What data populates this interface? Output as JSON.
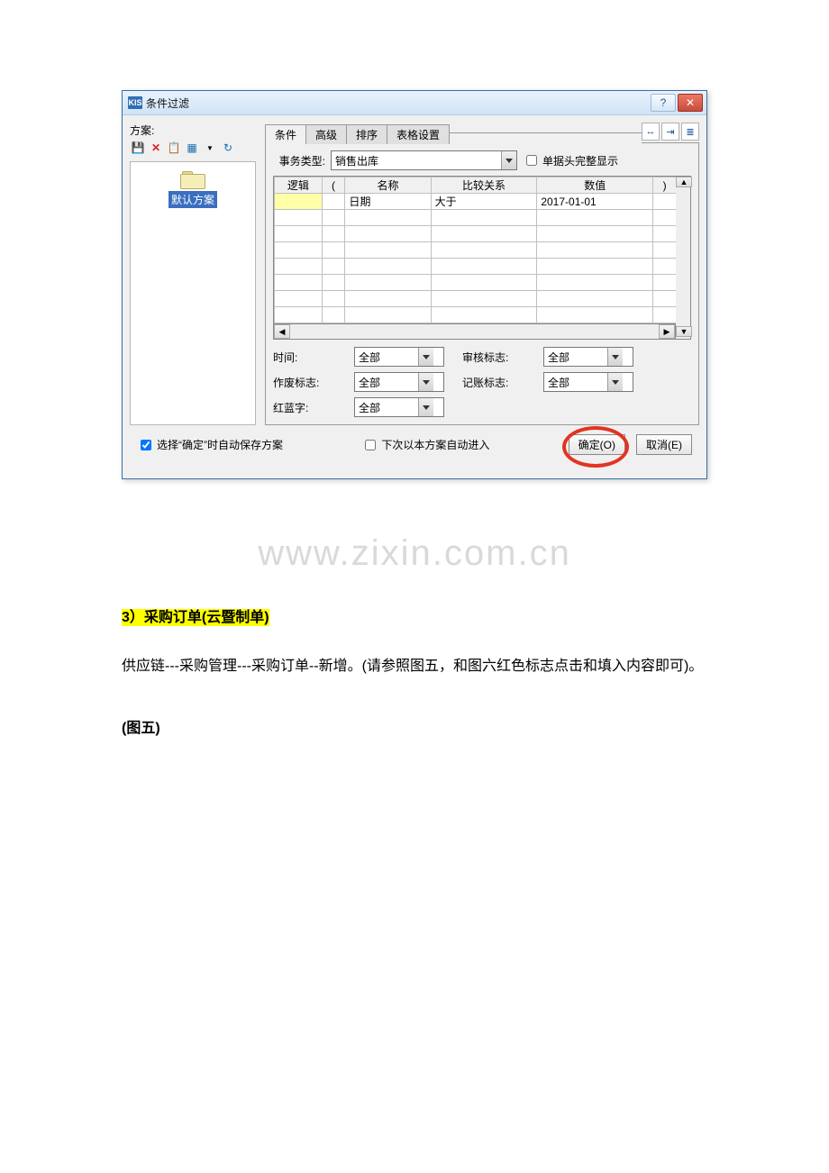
{
  "window": {
    "icon_text": "KIS",
    "title": "条件过滤",
    "help_symbol": "?",
    "close_symbol": "✕"
  },
  "left_pane": {
    "label": "方案:",
    "toolbar": {
      "save": "💾",
      "delete": "✕",
      "copy": "📋",
      "grid": "▦",
      "tri": "▼",
      "refresh": "↻"
    },
    "default_scheme": "默认方案"
  },
  "tabs": {
    "condition": "条件",
    "advanced": "高级",
    "sort": "排序",
    "table_settings": "表格设置"
  },
  "tab_icons": {
    "a": "↔",
    "b": "⇥",
    "c": "≣"
  },
  "business_type": {
    "label": "事务类型:",
    "value": "销售出库"
  },
  "full_display": {
    "label": "单据头完整显示"
  },
  "grid": {
    "headers": {
      "logic": "逻辑",
      "lparen": "(",
      "name": "名称",
      "compare": "比较关系",
      "value": "数值",
      "rparen": ")"
    },
    "row1": {
      "logic": "",
      "lparen": "",
      "name": "日期",
      "compare": "大于",
      "value": "2017-01-01",
      "rparen": ""
    }
  },
  "scroll": {
    "left": "◀",
    "right": "▶",
    "up": "▲",
    "down": "▼"
  },
  "filters": {
    "time_label": "时间:",
    "time_value": "全部",
    "audit_label": "审核标志:",
    "audit_value": "全部",
    "void_label": "作废标志:",
    "void_value": "全部",
    "book_label": "记账标志:",
    "book_value": "全部",
    "redblue_label": "红蓝字:",
    "redblue_value": "全部"
  },
  "bottom": {
    "auto_save": "选择“确定”时自动保存方案",
    "auto_enter": "下次以本方案自动进入",
    "ok": "确定(O)",
    "cancel": "取消(E)"
  },
  "watermark_text": "www.zixin.com.cn",
  "doc": {
    "section3": "3）采购订单(云暨制单)",
    "para1": "供应链---采购管理---采购订单--新增。(请参照图五，和图六红色标志点击和填入内容即可)。",
    "figure5": "(图五)"
  }
}
